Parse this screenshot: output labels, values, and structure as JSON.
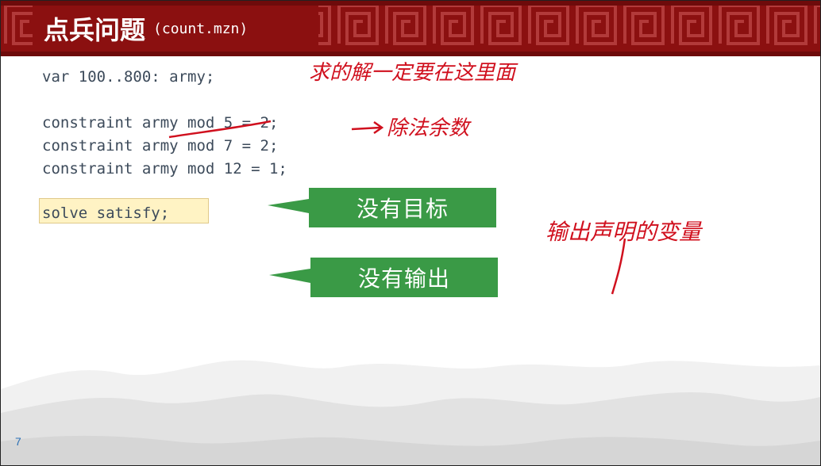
{
  "title": {
    "main": "点兵问题",
    "sub": "(count.mzn)"
  },
  "code": {
    "line1": "var 100..800: army;",
    "line2": "constraint army mod 5 = 2;",
    "line3": "constraint army mod 7 = 2;",
    "line4": "constraint army mod 12 = 1;",
    "solve": "solve satisfy;"
  },
  "callouts": {
    "no_objective": "没有目标",
    "no_output": "没有输出"
  },
  "annotations": {
    "note1": "求的解一定要在这里面",
    "note2": "除法余数",
    "note3": "输出声明的变量"
  },
  "page_number": "7",
  "colors": {
    "header": "#8b1010",
    "callout": "#3a9a46",
    "ink": "#d0101e"
  }
}
